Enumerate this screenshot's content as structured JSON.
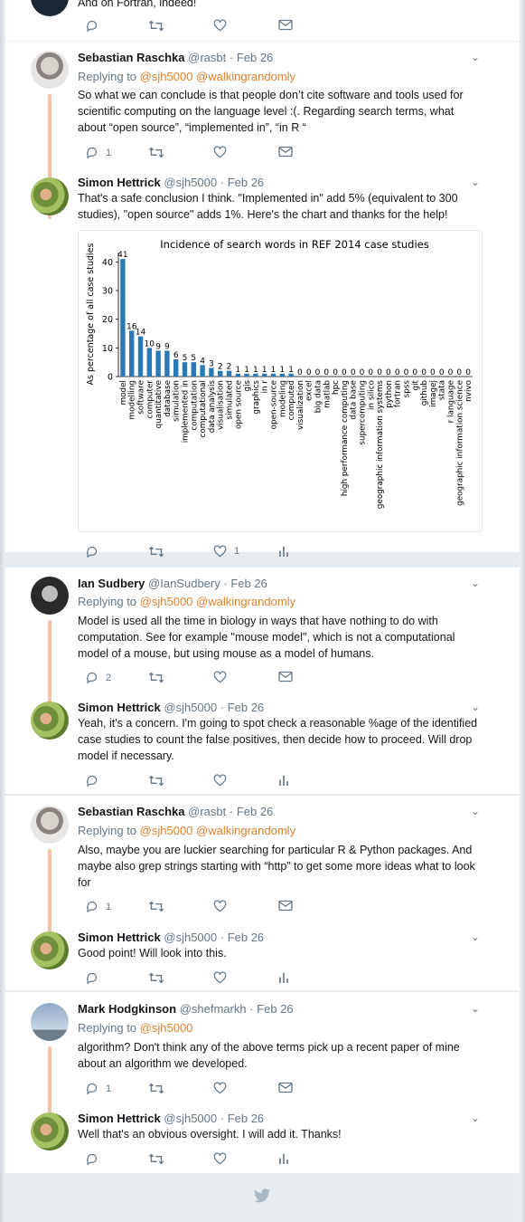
{
  "top_partial": {
    "text": "And on Fortran, indeed!"
  },
  "tweets": [
    {
      "name": "Sebastian Raschka",
      "handle": "@rasbt",
      "date": "· Feb 26",
      "replying_label": "Replying to",
      "replying_users": "@sjh5000 @walkingrandomly",
      "text": "So what we can conclude is that people don’t cite software and tools used for scientific computing on the language level :(. Regarding search terms, what about “open source”, “implemented in”, “in R “",
      "reply_count": "1"
    },
    {
      "name": "Simon Hettrick",
      "handle": "@sjh5000",
      "date": "· Feb 26",
      "text": "That's a safe conclusion I think. \"Implemented in\" add 5% (equivalent to 300 studies), \"open source\" adds 1%. Here's the chart and thanks for the help!",
      "like_count": "1"
    },
    {
      "name": "Ian Sudbery",
      "handle": "@IanSudbery",
      "date": "· Feb 26",
      "replying_label": "Replying to",
      "replying_users": "@sjh5000 @walkingrandomly",
      "text": "Model is used all the time in biology in ways that have nothing to do with computation. See for example \"mouse model\", which is not a computational model of a mouse, but using mouse as a model of humans.",
      "reply_count": "2"
    },
    {
      "name": "Simon Hettrick",
      "handle": "@sjh5000",
      "date": "· Feb 26",
      "text": "Yeah, it's a concern. I'm going to spot check a reasonable %age of the identified case studies to count the false positives, then decide how to proceed. Will drop model if necessary."
    },
    {
      "name": "Sebastian Raschka",
      "handle": "@rasbt",
      "date": "· Feb 26",
      "replying_label": "Replying to",
      "replying_users": "@sjh5000 @walkingrandomly",
      "text": "Also, maybe you are luckier searching for particular R & Python packages. And maybe also grep strings starting with “http” to get some more ideas what to look for",
      "reply_count": "1"
    },
    {
      "name": "Simon Hettrick",
      "handle": "@sjh5000",
      "date": "· Feb 26",
      "text": "Good point! Will look into this."
    },
    {
      "name": "Mark Hodgkinson",
      "handle": "@shefmarkh",
      "date": "· Feb 26",
      "replying_label": "Replying to",
      "replying_users": "@sjh5000",
      "text": "algorithm? Don't think any of the above terms pick up a recent paper of mine about an algorithm we developed.",
      "reply_count": "1"
    },
    {
      "name": "Simon Hettrick",
      "handle": "@sjh5000",
      "date": "· Feb 26",
      "text": "Well that's an obvious oversight. I will add it. Thanks!"
    }
  ],
  "colors": {
    "accent": "#e0802b",
    "thread": "#f7c1a7",
    "bar": "#2878b5",
    "muted": "#657786"
  },
  "chart_data": {
    "type": "bar",
    "title": "Incidence of search words in REF 2014 case studies",
    "ylabel": "As percentage of all case studies",
    "xlabel": "",
    "ylim": [
      0,
      42
    ],
    "yticks": [
      0,
      10,
      20,
      30,
      40
    ],
    "grid": false,
    "categories": [
      "model",
      "modelling",
      "software",
      "computer",
      "quantitative",
      "database",
      "simulation",
      "implemented in",
      "computation",
      "computational",
      "data analysis",
      "visualisation",
      "simulated",
      "open source",
      "gis",
      "graphics",
      "in r",
      "open-source",
      "modeling",
      "computed",
      "visualization",
      "excel",
      "big data",
      "matlab",
      "hpc",
      "high performance computing",
      "data base",
      "supercomputing",
      "in silico",
      "geographic information systems",
      "python",
      "fortran",
      "spss",
      "git",
      "github",
      "imagej",
      "stata",
      "r language",
      "geographic information science",
      "nvivo"
    ],
    "values": [
      41,
      16,
      14,
      10,
      9,
      9,
      6,
      5,
      5,
      4,
      3,
      2,
      2,
      1,
      1,
      1,
      1,
      1,
      1,
      1,
      0,
      0,
      0,
      0,
      0,
      0,
      0,
      0,
      0,
      0,
      0,
      0,
      0,
      0,
      0,
      0,
      0,
      0,
      0,
      0
    ],
    "labels": [
      "41",
      "16",
      "14",
      "10",
      "9",
      "9",
      "6",
      "5",
      "5",
      "4",
      "3",
      "2",
      "2",
      "1",
      "1",
      "1",
      "1",
      "1",
      "1",
      "1",
      "0",
      "0",
      "0",
      "0",
      "0",
      "0",
      "0",
      "0",
      "0",
      "0",
      "0",
      "0",
      "0",
      "0",
      "0",
      "0",
      "0",
      "0",
      "0",
      "0"
    ]
  }
}
